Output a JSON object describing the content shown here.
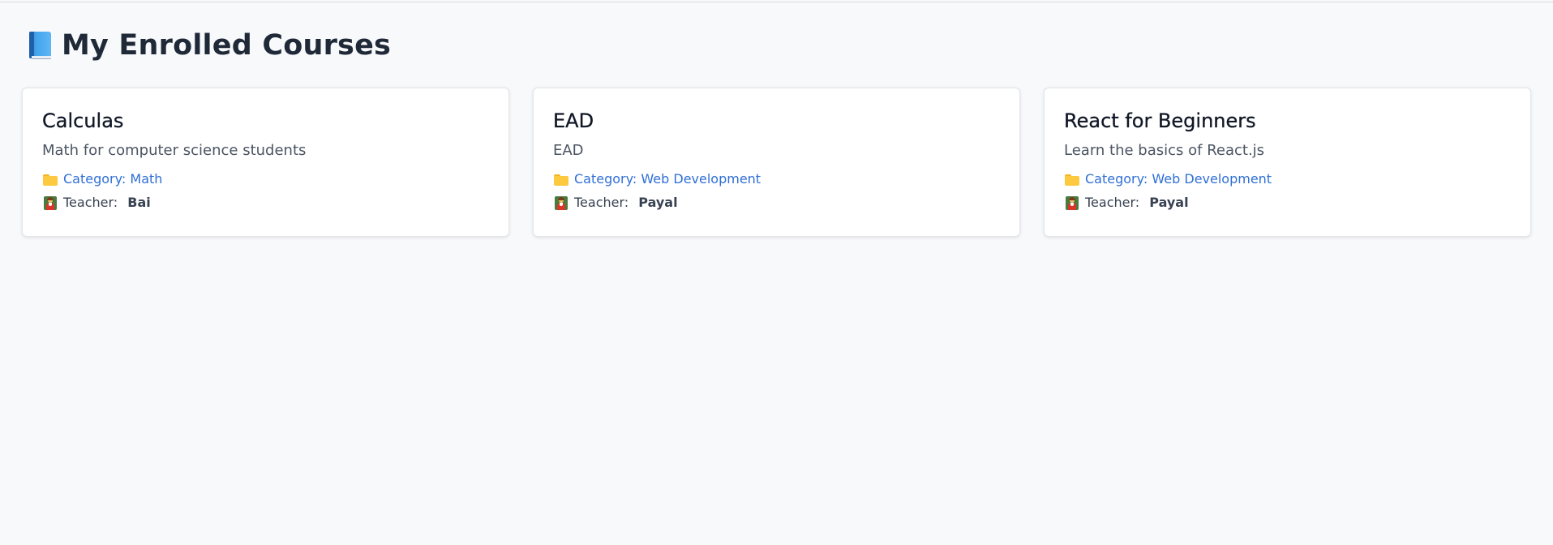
{
  "page": {
    "title": "My Enrolled Courses",
    "title_icon": "blue-book-icon"
  },
  "courses": [
    {
      "title": "Calculas",
      "description": "Math for computer science students",
      "category_label": "Category: Math",
      "teacher_label": "Teacher:",
      "teacher_name": "Bai"
    },
    {
      "title": "EAD",
      "description": "EAD",
      "category_label": "Category: Web Development",
      "teacher_label": "Teacher:",
      "teacher_name": "Payal"
    },
    {
      "title": "React for Beginners",
      "description": "Learn the basics of React.js",
      "category_label": "Category: Web Development",
      "teacher_label": "Teacher:",
      "teacher_name": "Payal"
    }
  ],
  "icons": {
    "category": "folder-icon",
    "teacher": "teacher-icon"
  },
  "colors": {
    "background": "#f8f9fb",
    "card_background": "#ffffff",
    "title_text": "#1f2937",
    "category_link": "#2f6fd6",
    "muted_text": "#4b5563"
  }
}
